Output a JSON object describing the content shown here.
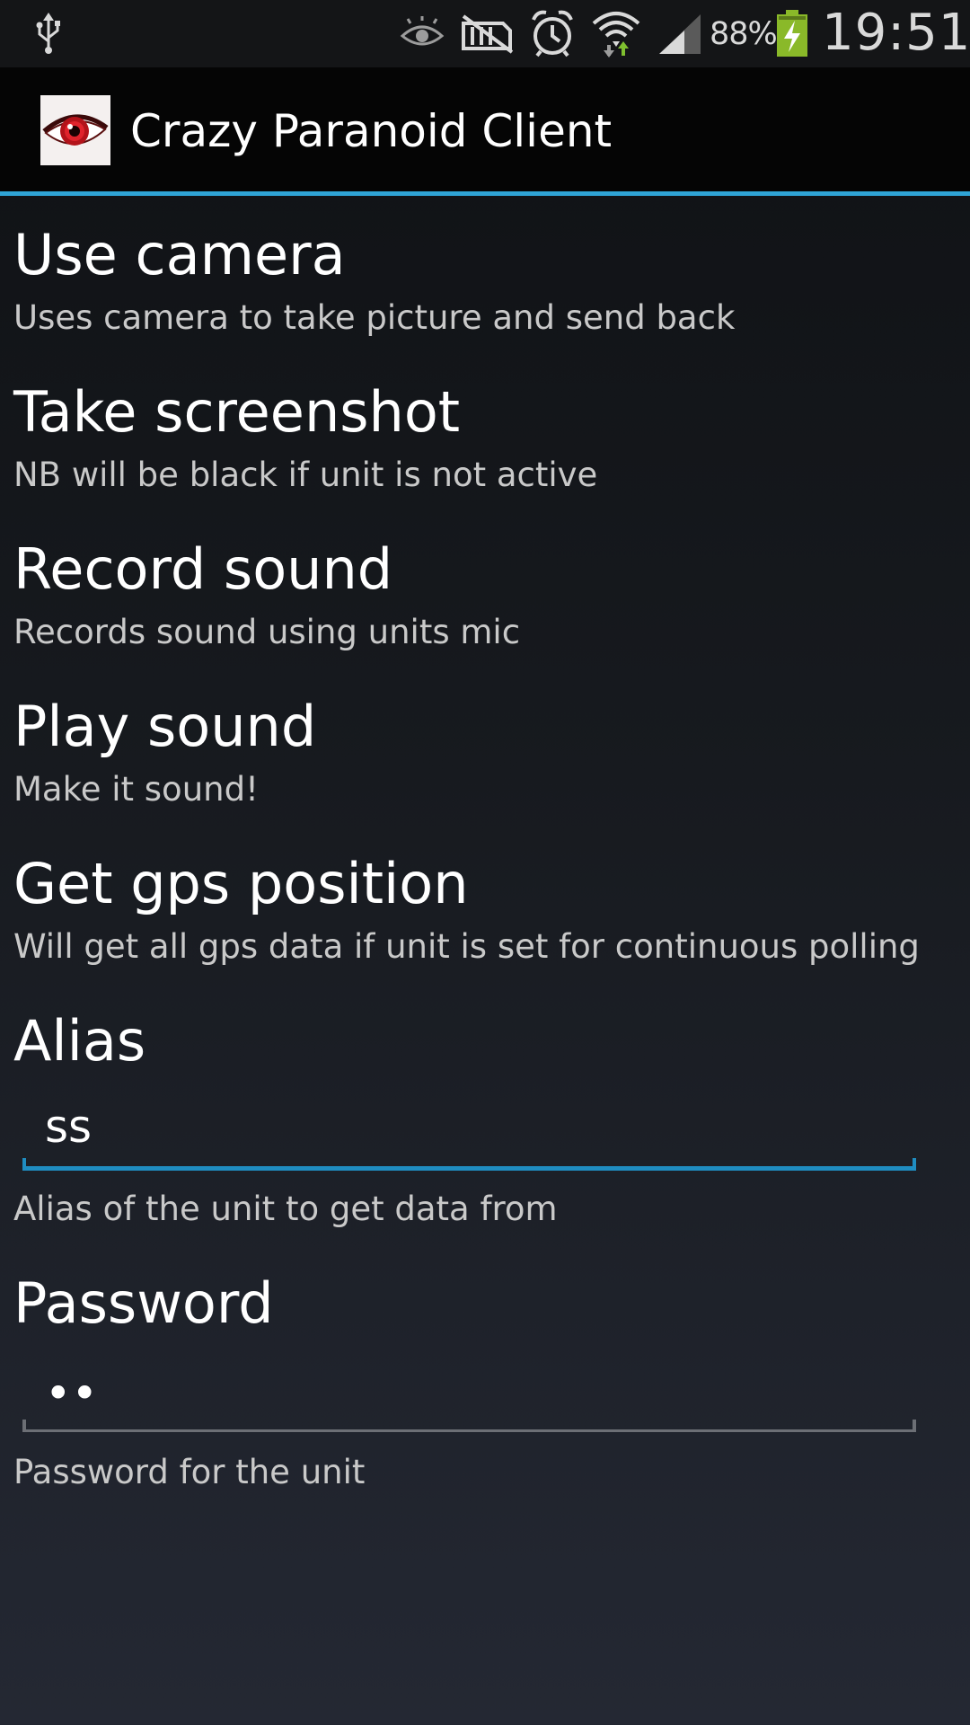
{
  "status_bar": {
    "battery_percent": "88%",
    "time": "19:51",
    "icons": [
      "usb-icon",
      "eye-icon",
      "no-sim-icon",
      "alarm-icon",
      "wifi-icon",
      "signal-icon",
      "battery-charging-icon"
    ]
  },
  "action_bar": {
    "app_icon": "red-eye-icon",
    "title": "Crazy Paranoid Client",
    "accent_color": "#2fa4d6"
  },
  "preferences": [
    {
      "title": "Use camera",
      "summary": "Uses camera to take picture and send back"
    },
    {
      "title": "Take screenshot",
      "summary": "NB will be black if unit is not active"
    },
    {
      "title": "Record sound",
      "summary": "Records sound using units mic"
    },
    {
      "title": "Play sound",
      "summary": "Make it sound!"
    },
    {
      "title": "Get gps position",
      "summary": "Will get all gps data if unit is set for continuous polling"
    }
  ],
  "alias": {
    "title": "Alias",
    "value": "ss",
    "summary": "Alias of the unit to get data from"
  },
  "password": {
    "title": "Password",
    "value": "••",
    "summary": "Password for the unit"
  }
}
